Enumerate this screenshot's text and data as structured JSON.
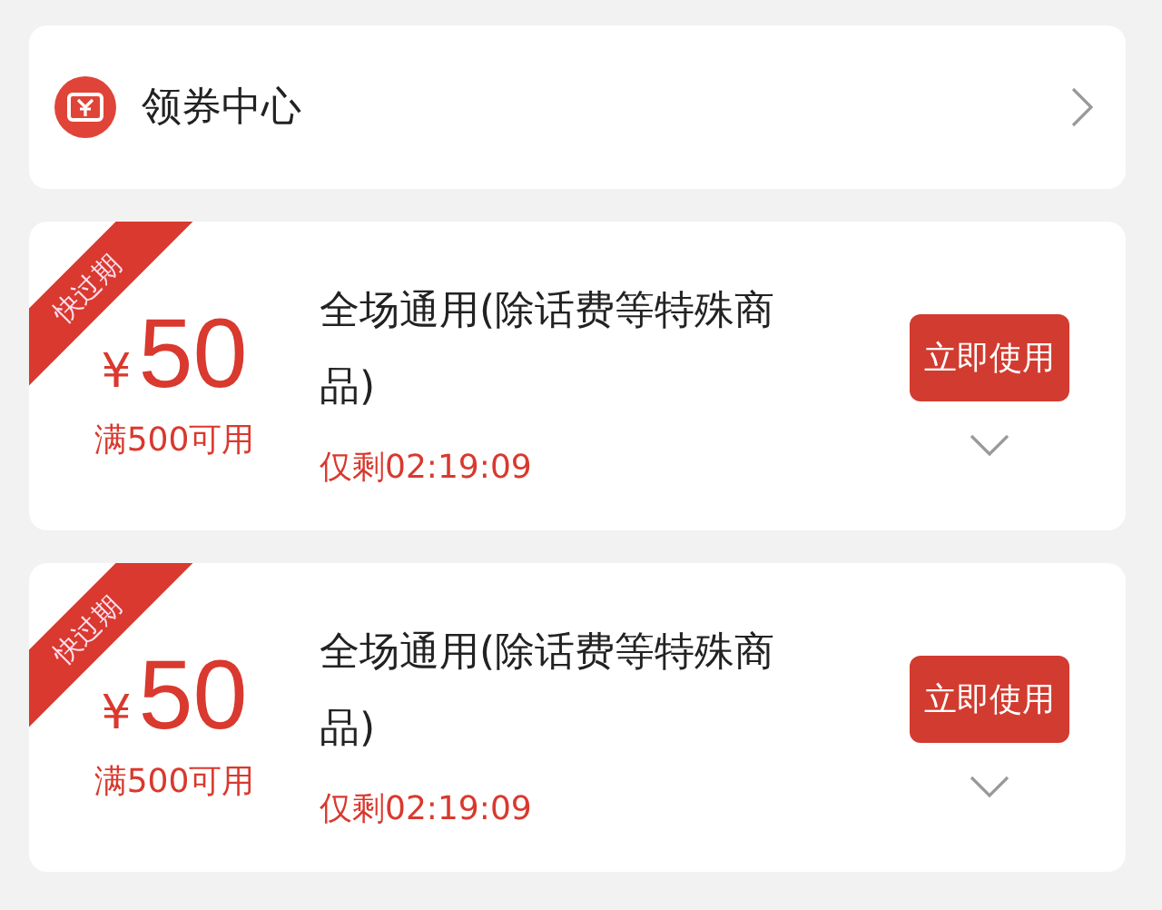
{
  "header": {
    "title": "领券中心"
  },
  "coupons": [
    {
      "ribbon": "快过期",
      "currency": "¥",
      "amount": "50",
      "condition": "满500可用",
      "title": "全场通用(除话费等特殊商品)",
      "countdown": "仅剩02:19:09",
      "button": "立即使用",
      "expanded": false
    },
    {
      "ribbon": "快过期",
      "currency": "¥",
      "amount": "50",
      "condition": "满500可用",
      "title": "全场通用(除话费等特殊商品)",
      "countdown": "仅剩02:19:09",
      "button": "立即使用",
      "expanded": false
    }
  ]
}
